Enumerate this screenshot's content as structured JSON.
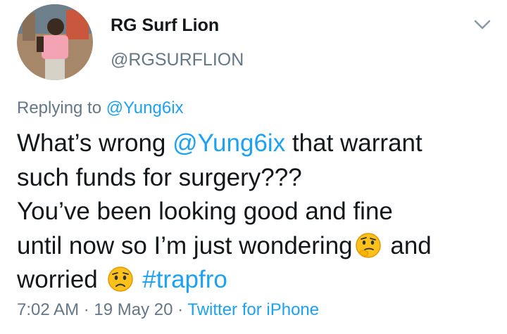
{
  "author": {
    "display_name": "RG Surf Lion",
    "handle": "@RGSURFLION"
  },
  "reply_context": {
    "prefix": "Replying to",
    "mention": "@Yung6ix"
  },
  "body": {
    "line1_a": "What’s wrong ",
    "line1_mention": "@Yung6ix",
    "line1_b": " that warrant",
    "line2": "such funds for surgery???",
    "line3": "You’ve been looking good and fine",
    "line4_a": "until now so I’m just wondering",
    "line4_b": "and",
    "line5_a": "worried",
    "hashtag": "#trapfro"
  },
  "meta": {
    "time": "7:02 AM",
    "sep1": " · ",
    "date": "19 May 20",
    "sep2": " · ",
    "source": "Twitter for iPhone"
  },
  "icons": {
    "menu": "chevron-down-icon",
    "emoji_1": "thinking-face-emoji",
    "emoji_2": "worried-face-emoji"
  },
  "colors": {
    "link": "#1da1f2",
    "secondary_text": "#657786",
    "primary_text": "#14171a"
  }
}
